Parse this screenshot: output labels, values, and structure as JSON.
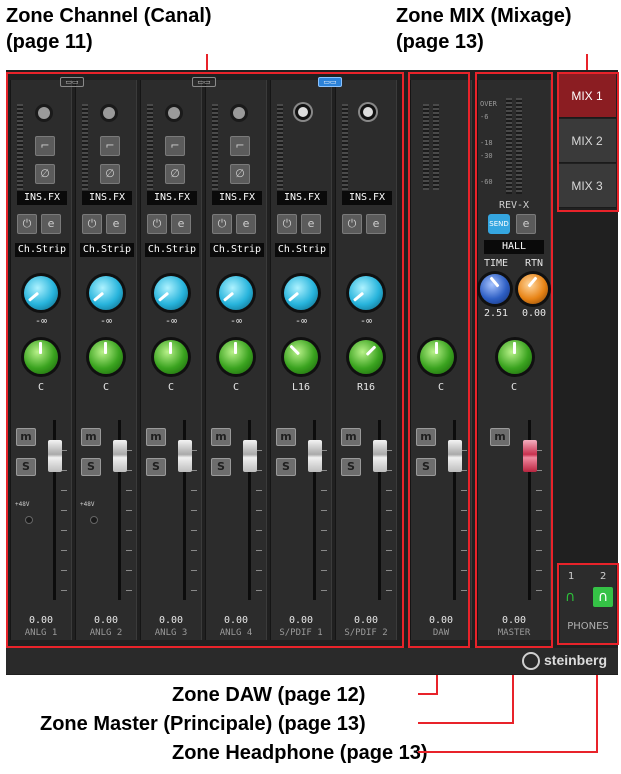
{
  "annotations": {
    "channel_zone_line1": "Zone Channel (Canal)",
    "channel_zone_line2": "(page 11)",
    "mix_zone_line1": "Zone MIX (Mixage)",
    "mix_zone_line2": "(page 13)",
    "daw_zone": "Zone DAW (page 12)",
    "master_zone": "Zone Master (Principale) (page 13)",
    "headphone_zone": "Zone Headphone (page 13)"
  },
  "channels": [
    {
      "name": "ANLG 1",
      "fx": "INS.FX",
      "strip": "Ch.Strip",
      "level": "-∞",
      "pan": "C",
      "volume": "0.00",
      "phantom": "+48V"
    },
    {
      "name": "ANLG 2",
      "fx": "INS.FX",
      "strip": "Ch.Strip",
      "level": "-∞",
      "pan": "C",
      "volume": "0.00",
      "phantom": "+48V"
    },
    {
      "name": "ANLG 3",
      "fx": "INS.FX",
      "strip": "Ch.Strip",
      "level": "-∞",
      "pan": "C",
      "volume": "0.00"
    },
    {
      "name": "ANLG 4",
      "fx": "INS.FX",
      "strip": "Ch.Strip",
      "level": "-∞",
      "pan": "C",
      "volume": "0.00"
    },
    {
      "name": "S/PDIF 1",
      "fx": "INS.FX",
      "strip": "Ch.Strip",
      "level": "-∞",
      "pan": "L16",
      "volume": "0.00"
    },
    {
      "name": "S/PDIF 2",
      "fx": "INS.FX",
      "pan": "R16",
      "level": "-∞",
      "volume": "0.00"
    }
  ],
  "daw": {
    "name": "DAW",
    "pan": "C",
    "volume": "0.00"
  },
  "master": {
    "name": "MASTER",
    "meter_labels": [
      "OVER",
      "-6",
      "-18",
      "-30",
      "-60"
    ],
    "reverb_title": "REV-X",
    "send_label": "SEND",
    "reverb_type": "HALL",
    "time_label": "TIME",
    "time_value": "2.51",
    "rtn_label": "RTN",
    "rtn_value": "0.00",
    "pan": "C",
    "volume": "0.00"
  },
  "mix_buttons": [
    "MIX 1",
    "MIX 2",
    "MIX 3"
  ],
  "phones": {
    "label": "PHONES",
    "ch1": "1",
    "ch2": "2"
  },
  "brand": "steinberg",
  "colors": {
    "zone_border": "#e8232a",
    "accent_active": "#8b1d22",
    "fader_master": "#d84a6a"
  }
}
